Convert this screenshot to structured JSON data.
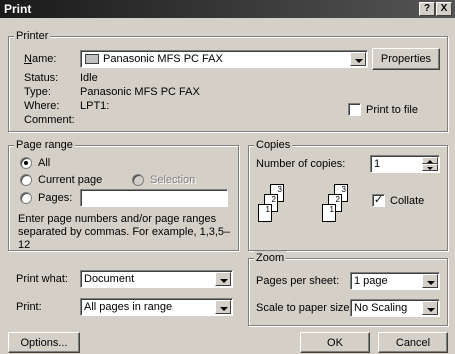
{
  "window": {
    "title": "Print",
    "help_btn": "?",
    "close_btn": "X"
  },
  "printer": {
    "group_label": "Printer",
    "name_label": "Name:",
    "name_value": "Panasonic MFS PC FAX",
    "properties_label": "Properties",
    "status_label": "Status:",
    "status_value": "Idle",
    "type_label": "Type:",
    "type_value": "Panasonic MFS PC FAX",
    "where_label": "Where:",
    "where_value": "LPT1:",
    "comment_label": "Comment:",
    "comment_value": "",
    "print_to_file_label": "Print to file",
    "print_to_file_checked": false
  },
  "page_range": {
    "group_label": "Page range",
    "all_label": "All",
    "current_page_label": "Current page",
    "selection_label": "Selection",
    "pages_label": "Pages:",
    "pages_value": "",
    "selected": "all",
    "hint": "Enter page numbers and/or page ranges separated by commas.  For example, 1,3,5–12"
  },
  "copies": {
    "group_label": "Copies",
    "number_label": "Number of copies:",
    "number_value": "1",
    "collate_label": "Collate",
    "collate_checked": true
  },
  "print_what": {
    "label": "Print what:",
    "value": "Document"
  },
  "print": {
    "label": "Print:",
    "value": "All pages in range"
  },
  "zoom": {
    "group_label": "Zoom",
    "pages_per_sheet_label": "Pages per sheet:",
    "pages_per_sheet_value": "1 page",
    "scale_label": "Scale to paper size:",
    "scale_value": "No Scaling"
  },
  "buttons": {
    "options": "Options...",
    "ok": "OK",
    "cancel": "Cancel"
  }
}
